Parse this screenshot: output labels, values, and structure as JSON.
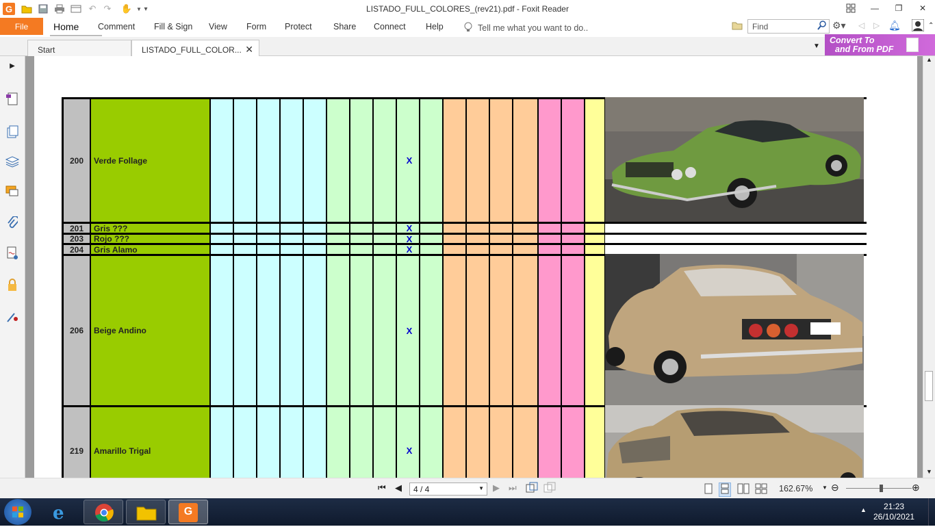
{
  "window": {
    "title": "LISTADO_FULL_COLORES_(rev21).pdf - Foxit Reader"
  },
  "ribbon": {
    "file": "File",
    "menus": [
      "Home",
      "Comment",
      "Fill & Sign",
      "View",
      "Form",
      "Protect",
      "Share",
      "Connect",
      "Help"
    ],
    "tell_me": "Tell me what you want to do..",
    "find_placeholder": "Find"
  },
  "tabs": {
    "start": "Start",
    "doc": "LISTADO_FULL_COLOR..."
  },
  "convert": {
    "line1": "Convert To",
    "line2": "and From PDF"
  },
  "table": {
    "rows": [
      {
        "num": "200",
        "name": "Verde Follage",
        "mark": "X"
      },
      {
        "num": "201",
        "name": "Gris ???",
        "mark": "X"
      },
      {
        "num": "203",
        "name": "Rojo ???",
        "mark": "X"
      },
      {
        "num": "204",
        "name": "Gris Alamo",
        "mark": "X"
      },
      {
        "num": "206",
        "name": "Beige Andino",
        "mark": "X"
      },
      {
        "num": "219",
        "name": "Amarillo Trigal",
        "mark": "X"
      }
    ],
    "colors": {
      "cyan": "#ccffff",
      "green": "#ccffcc",
      "orange": "#ffcc99",
      "pink": "#ff99cc",
      "yellow": "#ffff99",
      "name": "#99cc00",
      "num": "#c0c0c0"
    }
  },
  "nav": {
    "page": "4 / 4",
    "zoom": "162.67%"
  },
  "taskbar": {
    "time": "21:23",
    "date": "26/10/2021"
  }
}
